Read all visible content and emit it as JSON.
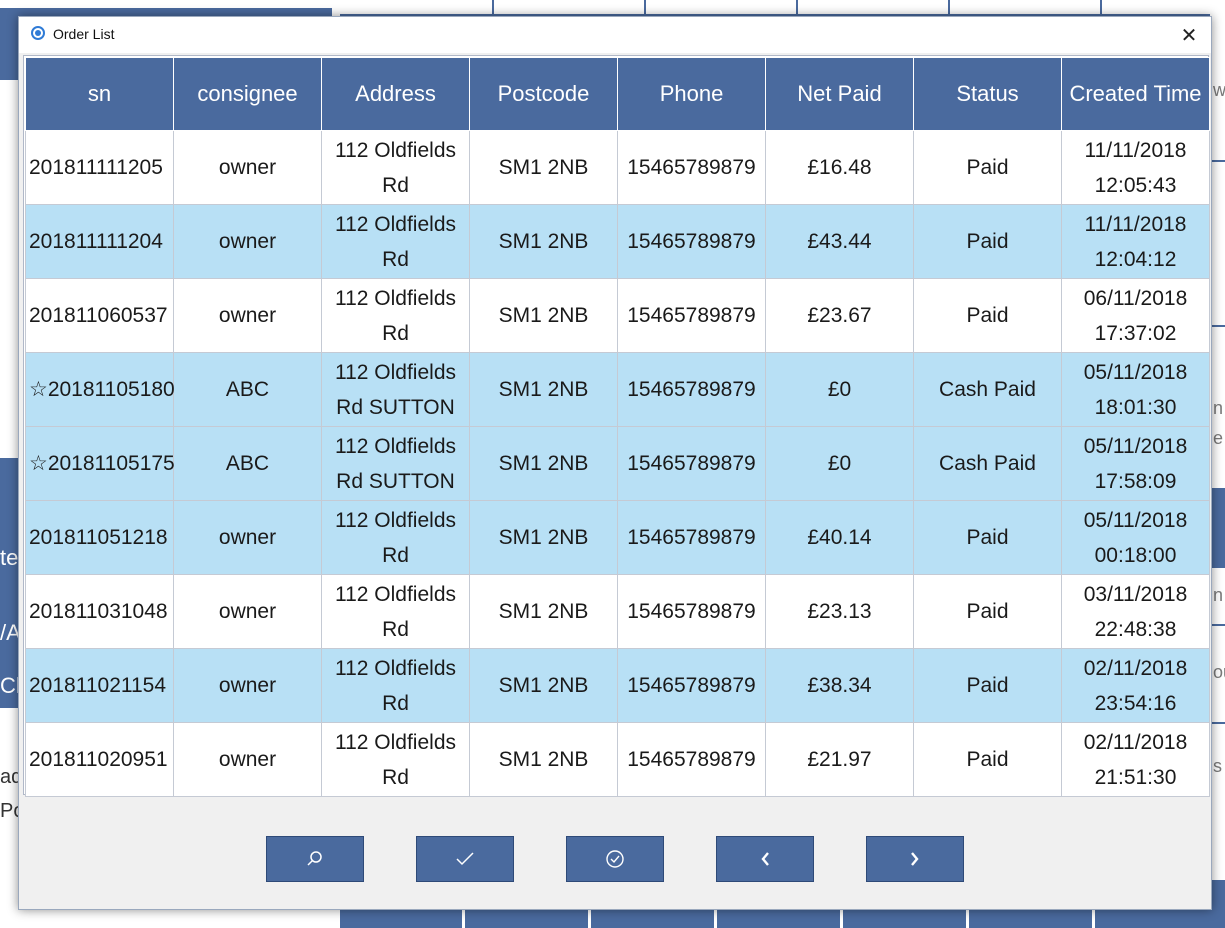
{
  "window": {
    "title": "Order List"
  },
  "table": {
    "columns": [
      "sn",
      "consignee",
      "Address",
      "Postcode",
      "Phone",
      "Net Paid",
      "Status",
      "Created Time"
    ],
    "rows": [
      {
        "sn": "201811111205",
        "consignee": "owner",
        "address_line1": "112 Oldfields",
        "address_line2": "Rd",
        "postcode": "SM1 2NB",
        "phone": "15465789879",
        "net_paid": "£16.48",
        "status": "Paid",
        "date": "11/11/2018",
        "time": "12:05:43"
      },
      {
        "sn": "201811111204",
        "consignee": "owner",
        "address_line1": "112 Oldfields",
        "address_line2": "Rd",
        "postcode": "SM1 2NB",
        "phone": "15465789879",
        "net_paid": "£43.44",
        "status": "Paid",
        "date": "11/11/2018",
        "time": "12:04:12"
      },
      {
        "sn": "201811060537",
        "consignee": "owner",
        "address_line1": "112 Oldfields",
        "address_line2": "Rd",
        "postcode": "SM1 2NB",
        "phone": "15465789879",
        "net_paid": "£23.67",
        "status": "Paid",
        "date": "06/11/2018",
        "time": "17:37:02"
      },
      {
        "sn": "☆20181105180",
        "consignee": "ABC",
        "address_line1": "112 Oldfields",
        "address_line2": "Rd SUTTON",
        "postcode": "SM1 2NB",
        "phone": "15465789879",
        "net_paid": "£0",
        "status": "Cash Paid",
        "date": "05/11/2018",
        "time": "18:01:30"
      },
      {
        "sn": "☆20181105175",
        "consignee": "ABC",
        "address_line1": "112 Oldfields",
        "address_line2": "Rd SUTTON",
        "postcode": "SM1 2NB",
        "phone": "15465789879",
        "net_paid": "£0",
        "status": "Cash Paid",
        "date": "05/11/2018",
        "time": "17:58:09"
      },
      {
        "sn": "201811051218",
        "consignee": "owner",
        "address_line1": "112 Oldfields",
        "address_line2": "Rd",
        "postcode": "SM1 2NB",
        "phone": "15465789879",
        "net_paid": "£40.14",
        "status": "Paid",
        "date": "05/11/2018",
        "time": "00:18:00"
      },
      {
        "sn": "201811031048",
        "consignee": "owner",
        "address_line1": "112 Oldfields",
        "address_line2": "Rd",
        "postcode": "SM1 2NB",
        "phone": "15465789879",
        "net_paid": "£23.13",
        "status": "Paid",
        "date": "03/11/2018",
        "time": "22:48:38"
      },
      {
        "sn": "201811021154",
        "consignee": "owner",
        "address_line1": "112 Oldfields",
        "address_line2": "Rd",
        "postcode": "SM1 2NB",
        "phone": "15465789879",
        "net_paid": "£38.34",
        "status": "Paid",
        "date": "02/11/2018",
        "time": "23:54:16"
      },
      {
        "sn": "201811020951",
        "consignee": "owner",
        "address_line1": "112 Oldfields",
        "address_line2": "Rd",
        "postcode": "SM1 2NB",
        "phone": "15465789879",
        "net_paid": "£21.97",
        "status": "Paid",
        "date": "02/11/2018",
        "time": "21:51:30"
      }
    ],
    "row_highlight": [
      false,
      true,
      false,
      true,
      true,
      true,
      false,
      true,
      false
    ]
  },
  "toolbar": {
    "buttons": [
      {
        "icon": "search-icon"
      },
      {
        "icon": "checkmark-icon"
      },
      {
        "icon": "circle-check-icon"
      },
      {
        "icon": "chevron-left-icon"
      },
      {
        "icon": "chevron-right-icon"
      }
    ]
  },
  "background": {
    "left_fragments": [
      "te",
      "/A",
      "Ch",
      "ad",
      "Po"
    ],
    "right_fragments": [
      "w",
      "n",
      "e",
      "n",
      "ou",
      "s"
    ]
  },
  "colors": {
    "header_bg": "#4a6a9e",
    "row_highlight_bg": "#b8e0f5",
    "row_plain_bg": "#ffffff",
    "button_bg": "#4a6a9e"
  }
}
